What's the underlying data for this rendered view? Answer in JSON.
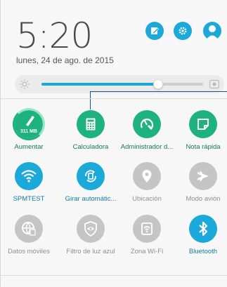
{
  "header": {
    "time": "5:20",
    "date": "lunes, 24 de ago. de 2015",
    "icons": [
      "edit-icon",
      "settings-icon",
      "user-avatar-icon"
    ]
  },
  "brightness": {
    "level": 0.72,
    "low_icon": "brightness-low-icon",
    "auto_icon": "brightness-auto-icon"
  },
  "tiles": [
    {
      "label": "Aumentar",
      "badge": "311 MB",
      "state": "green",
      "icon": "boost-brush-icon"
    },
    {
      "label": "Calculadora",
      "state": "green",
      "icon": "calculator-icon"
    },
    {
      "label": "Administrador d...",
      "state": "green",
      "icon": "speed-wrench-icon"
    },
    {
      "label": "Nota rápida",
      "state": "green",
      "icon": "quick-note-icon"
    },
    {
      "label": "SPMTEST",
      "state": "blue",
      "icon": "wifi-icon"
    },
    {
      "label": "Girar automátic...",
      "state": "blue",
      "icon": "auto-rotate-icon"
    },
    {
      "label": "Ubicación",
      "state": "grey",
      "icon": "location-pin-icon"
    },
    {
      "label": "Modo avión",
      "state": "grey",
      "icon": "airplane-icon"
    },
    {
      "label": "Datos móviles",
      "state": "grey",
      "icon": "mobile-data-icon"
    },
    {
      "label": "Filtro de luz azul",
      "state": "grey",
      "icon": "eye-shield-icon"
    },
    {
      "label": "Zona Wi-Fi",
      "state": "grey",
      "icon": "hotspot-icon"
    },
    {
      "label": "Bluetooth",
      "state": "blue",
      "icon": "bluetooth-icon"
    }
  ],
  "colors": {
    "accent_blue": "#1aa9d8",
    "accent_green": "#1db27e",
    "inactive_grey": "#c5c5c5"
  }
}
